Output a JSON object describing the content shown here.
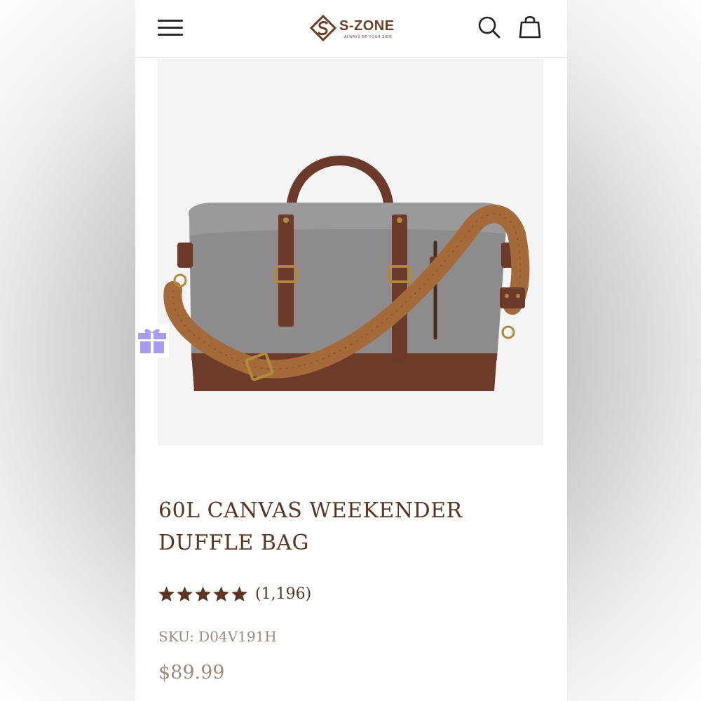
{
  "header": {
    "menu_icon": "hamburger-menu-icon",
    "logo": {
      "name": "S-ZONE",
      "tagline": "ALWAYS BE YOUR SIDE",
      "icon": "s-diamond-logo-icon"
    },
    "search_icon": "search-icon",
    "cart_icon": "shopping-bag-icon"
  },
  "gift_icon": "gift-icon",
  "product": {
    "title_line1": "60L CANVAS WEEKENDER",
    "title_line2": "DUFFLE BAG",
    "rating_stars": 5,
    "review_count": "(1,196)",
    "sku": "SKU: D04V191H",
    "price": "$89.99",
    "image_alt": "Gray canvas weekender duffle bag with brown leather handles and shoulder strap"
  },
  "colors": {
    "brand_brown": "#5a3522",
    "muted_text": "#a08a7c",
    "gift_purple": "#a89bf2",
    "canvas_gray": "#8d8b8c",
    "leather_brown": "#6b3a2a",
    "strap_tan": "#a46a3a"
  }
}
